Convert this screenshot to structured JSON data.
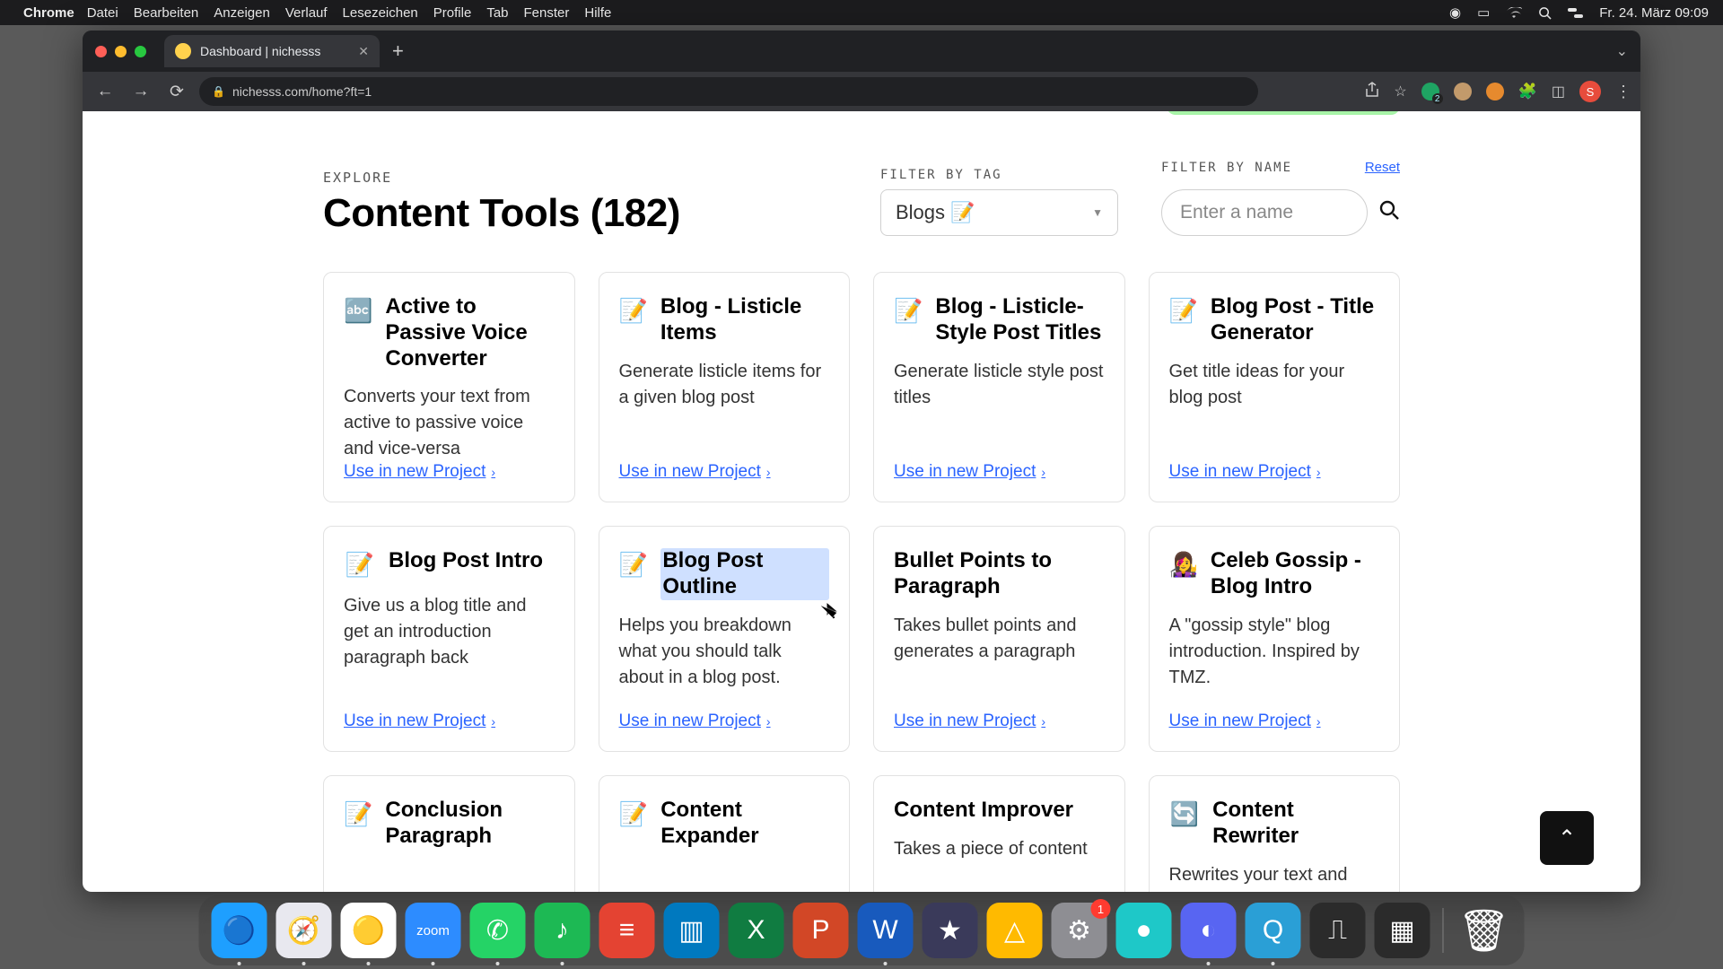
{
  "menu": {
    "app": "Chrome",
    "items": [
      "Datei",
      "Bearbeiten",
      "Anzeigen",
      "Verlauf",
      "Lesezeichen",
      "Profile",
      "Tab",
      "Fenster",
      "Hilfe"
    ],
    "date": "Fr. 24. März 09:09"
  },
  "browser": {
    "tab_title": "Dashboard | nichesss",
    "url": "nichesss.com/home?ft=1",
    "ext_badge": "2",
    "avatar_letter": "S"
  },
  "page": {
    "explore": "EXPLORE",
    "title": "Content Tools (182)",
    "filter_tag_label": "FILTER BY TAG",
    "filter_tag_value": "Blogs 📝",
    "filter_name_label": "FILTER BY NAME",
    "reset": "Reset",
    "search_placeholder": "Enter a name",
    "use_link": "Use in new Project",
    "cards": [
      {
        "icon": "🔤",
        "title": "Active to Passive Voice Converter",
        "desc": "Converts your text from active to passive voice and vice-versa"
      },
      {
        "icon": "📝",
        "title": "Blog - Listicle Items",
        "desc": "Generate listicle items for a given blog post"
      },
      {
        "icon": "📝",
        "title": "Blog - Listicle-Style Post Titles",
        "desc": "Generate listicle style post titles"
      },
      {
        "icon": "📝",
        "title": "Blog Post - Title Generator",
        "desc": "Get title ideas for your blog post"
      },
      {
        "icon": "📝",
        "title": "Blog Post Intro",
        "desc": "Give us a blog title and get an introduction paragraph back"
      },
      {
        "icon": "📝",
        "title": "Blog Post Outline",
        "desc": "Helps you breakdown what you should talk about in a blog post."
      },
      {
        "icon": "",
        "title": "Bullet Points to Paragraph",
        "desc": "Takes bullet points and generates a paragraph"
      },
      {
        "icon": "👩‍🎤",
        "title": "Celeb Gossip - Blog Intro",
        "desc": "A \"gossip style\" blog introduction. Inspired by TMZ."
      },
      {
        "icon": "📝",
        "title": "Conclusion Paragraph",
        "desc": ""
      },
      {
        "icon": "📝",
        "title": "Content Expander",
        "desc": ""
      },
      {
        "icon": "",
        "title": "Content Improver",
        "desc": "Takes a piece of content"
      },
      {
        "icon": "🔄",
        "title": "Content Rewriter",
        "desc": "Rewrites your text and"
      }
    ]
  },
  "dock": {
    "apps": [
      {
        "n": "finder",
        "c": "#1e9fff",
        "g": "🔵",
        "dot": true
      },
      {
        "n": "safari",
        "c": "#e8e8ef",
        "g": "🧭",
        "dot": true
      },
      {
        "n": "chrome",
        "c": "#fff",
        "g": "🟡",
        "dot": true
      },
      {
        "n": "zoom",
        "c": "#2d8cff",
        "g": "zm",
        "dot": true,
        "text": "zoom",
        "fs": "15"
      },
      {
        "n": "whatsapp",
        "c": "#25d366",
        "g": "✆",
        "dot": true
      },
      {
        "n": "spotify",
        "c": "#1db954",
        "g": "♪",
        "dot": true
      },
      {
        "n": "todoist",
        "c": "#e44332",
        "g": "≡",
        "dot": false
      },
      {
        "n": "trello",
        "c": "#0079bf",
        "g": "▥",
        "dot": false
      },
      {
        "n": "excel",
        "c": "#107c41",
        "g": "X",
        "dot": false
      },
      {
        "n": "powerpoint",
        "c": "#d24726",
        "g": "P",
        "dot": false
      },
      {
        "n": "word",
        "c": "#185abd",
        "g": "W",
        "dot": true
      },
      {
        "n": "imovie",
        "c": "#3a3a5a",
        "g": "★",
        "dot": false
      },
      {
        "n": "drive",
        "c": "#ffba00",
        "g": "△",
        "dot": false
      },
      {
        "n": "settings",
        "c": "#8e8e93",
        "g": "⚙",
        "dot": false,
        "badge": "1"
      },
      {
        "n": "siri",
        "c": "#1ec8c8",
        "g": "●",
        "dot": false
      },
      {
        "n": "discord",
        "c": "#5865f2",
        "g": "◐",
        "dot": true
      },
      {
        "n": "quicktime",
        "c": "#2a9fd6",
        "g": "Q",
        "dot": true
      },
      {
        "n": "voice",
        "c": "#2b2b2b",
        "g": "⎍",
        "dot": false
      },
      {
        "n": "mission",
        "c": "#2b2b2b",
        "g": "▦",
        "dot": false
      }
    ]
  }
}
